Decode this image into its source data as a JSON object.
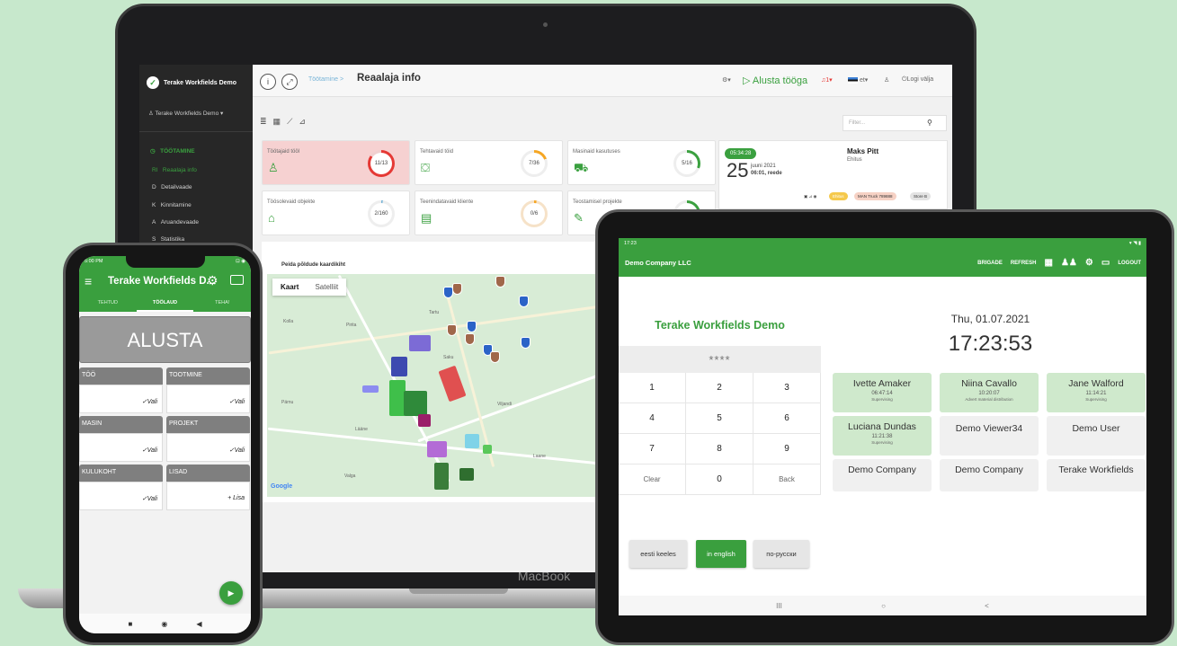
{
  "laptop": {
    "brand_label": "MacBook",
    "sidebar": {
      "brand": "Terake Workfields Demo",
      "user": "Terake Workfields Demo",
      "section": "TÖÖTAMINE",
      "items": [
        {
          "key": "RI",
          "label": "Reaalaja info"
        },
        {
          "key": "D",
          "label": "Detailvaade"
        },
        {
          "key": "K",
          "label": "Kinnitamine"
        },
        {
          "key": "A",
          "label": "Aruandevaade"
        },
        {
          "key": "S",
          "label": "Statistika"
        }
      ]
    },
    "topbar": {
      "breadcrumb": "Töötamine",
      "separator": ">",
      "title": "Reaalaja info",
      "start_label": "Alusta tööga",
      "alerts": "1",
      "language": "et",
      "logout": "Logi välja"
    },
    "filter_placeholder": "Filter...",
    "cards": [
      {
        "label": "Töötajaid tööl",
        "value": "11/13",
        "icon": "person-icon",
        "color": "#e53935"
      },
      {
        "label": "Tehtavaid töid",
        "value": "7/36",
        "icon": "toolbox-icon",
        "color": "#f5a623"
      },
      {
        "label": "Masinaid kasutuses",
        "value": "5/16",
        "icon": "truck-icon",
        "color": "#3aa03f"
      },
      {
        "label": "Töösolevaid objekte",
        "value": "2/160",
        "icon": "building-icon",
        "color": "#79b5d8"
      },
      {
        "label": "Teenindatavaid kliente",
        "value": "0/6",
        "icon": "id-card-icon",
        "color": "#f5a623"
      },
      {
        "label": "Teostamisel projekte",
        "value": "",
        "icon": "edit-icon",
        "color": "#3aa03f"
      }
    ],
    "timer": {
      "elapsed": "05:34:28",
      "day": "25",
      "month_year": "juuni 2021",
      "time_weekday": "06:01, reede",
      "name": "Maks Pitt",
      "role": "Ehitus",
      "tags": [
        "Ehitus",
        "MAN Truck 789888",
        "Store B"
      ]
    },
    "map": {
      "hint": "Peida põldude kaardikiht",
      "tabs": [
        "Kaart",
        "Satelliit"
      ],
      "towns": [
        "Kolla",
        "Pirita",
        "Tartu",
        "Lääne",
        "Pärnu",
        "Saku",
        "Viljandi",
        "Valga",
        "Laane"
      ],
      "logo": "Google"
    }
  },
  "phone": {
    "status_time": "5:00 PM",
    "status_right": "⊡ ◉",
    "title": "Terake Workfields D...",
    "tabs": [
      "TEHTUD",
      "TÖÖLAUD",
      "TEHA!"
    ],
    "start_label": "ALUSTA",
    "cells": [
      {
        "header": "TÖÖ",
        "action": "✓Vali"
      },
      {
        "header": "TOOTMINE",
        "action": "✓Vali"
      },
      {
        "header": "MASIN",
        "action": "✓Vali"
      },
      {
        "header": "PROJEKT",
        "action": "✓Vali"
      },
      {
        "header": "KULUKOHT",
        "action": "✓Vali"
      },
      {
        "header": "LISAD",
        "action": "+ Lisa"
      }
    ],
    "fab_icon": "play-icon"
  },
  "tablet": {
    "status_time": "17:23",
    "status_right": "▾ ◥ ▮",
    "company": "Demo Company LLC",
    "actions": [
      "BRIGADE",
      "REFRESH",
      "LOGOUT"
    ],
    "keypad_title": "Terake Workfields Demo",
    "pin_display": "****",
    "keys": [
      "1",
      "2",
      "3",
      "4",
      "5",
      "6",
      "7",
      "8",
      "9",
      "Clear",
      "0",
      "Back"
    ],
    "date": "Thu, 01.07.2021",
    "time": "17:23:53",
    "employees": [
      {
        "name": "Ivette  Amaker",
        "time": "06:47:14",
        "role": "Supervising",
        "active": true
      },
      {
        "name": "Niina  Cavallo",
        "time": "10:20:07",
        "role": "Advert material distribution",
        "active": true
      },
      {
        "name": "Jane Walford",
        "time": "11:14:21",
        "role": "Supervising",
        "active": true
      },
      {
        "name": "Luciana  Dundas",
        "time": "11:21:38",
        "role": "Supervising",
        "active": true
      },
      {
        "name": "Demo Viewer34",
        "time": "",
        "role": "",
        "active": false
      },
      {
        "name": "Demo User",
        "time": "",
        "role": "",
        "active": false
      },
      {
        "name": "Demo Company",
        "time": "",
        "role": "",
        "active": false
      },
      {
        "name": "Demo Company",
        "time": "",
        "role": "",
        "active": false
      },
      {
        "name": "Terake Workfields",
        "time": "",
        "role": "",
        "active": false
      }
    ],
    "languages": [
      "eesti keeles",
      "in english",
      "по-русски"
    ],
    "nav": [
      "III",
      "○",
      "<"
    ]
  },
  "colors": {
    "brand_green": "#3a9f3e",
    "background": "#c7e8cc",
    "sidebar_bg": "#272727"
  }
}
